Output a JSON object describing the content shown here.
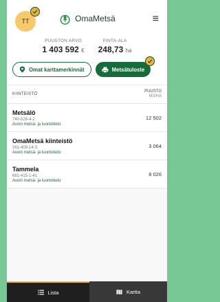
{
  "header": {
    "avatar_initials": "TT",
    "brand": "OmaMetsä"
  },
  "stats": {
    "value_label": "PUUSTON ARVO",
    "value": "1 403 592",
    "value_unit": "€",
    "area_label": "PINTA-ALA",
    "area": "248,73",
    "area_unit": "ha"
  },
  "actions": {
    "markers_label": "Omat karttamerkinnät",
    "print_label": "Metsätuloste"
  },
  "table": {
    "col_left": "KIINTEISTÖ",
    "col_right": "PUUSTO",
    "col_right_sub": "M3/HA"
  },
  "rows": [
    {
      "name": "Metsälö",
      "id": "740-528-4-2",
      "link": "Avoin metsä- ja luontotieto",
      "value": "12 502"
    },
    {
      "name": "OmaMetsä kiinteistö",
      "id": "261-409-14-3",
      "link": "Avoin metsä- ja luontotieto",
      "value": "3 064"
    },
    {
      "name": "Tammela",
      "id": "681-415-1-41",
      "link": "Avoin metsä- ja luontotieto",
      "value": "8 026"
    }
  ],
  "nav": {
    "list_label": "Lista",
    "map_label": "Kartta"
  }
}
